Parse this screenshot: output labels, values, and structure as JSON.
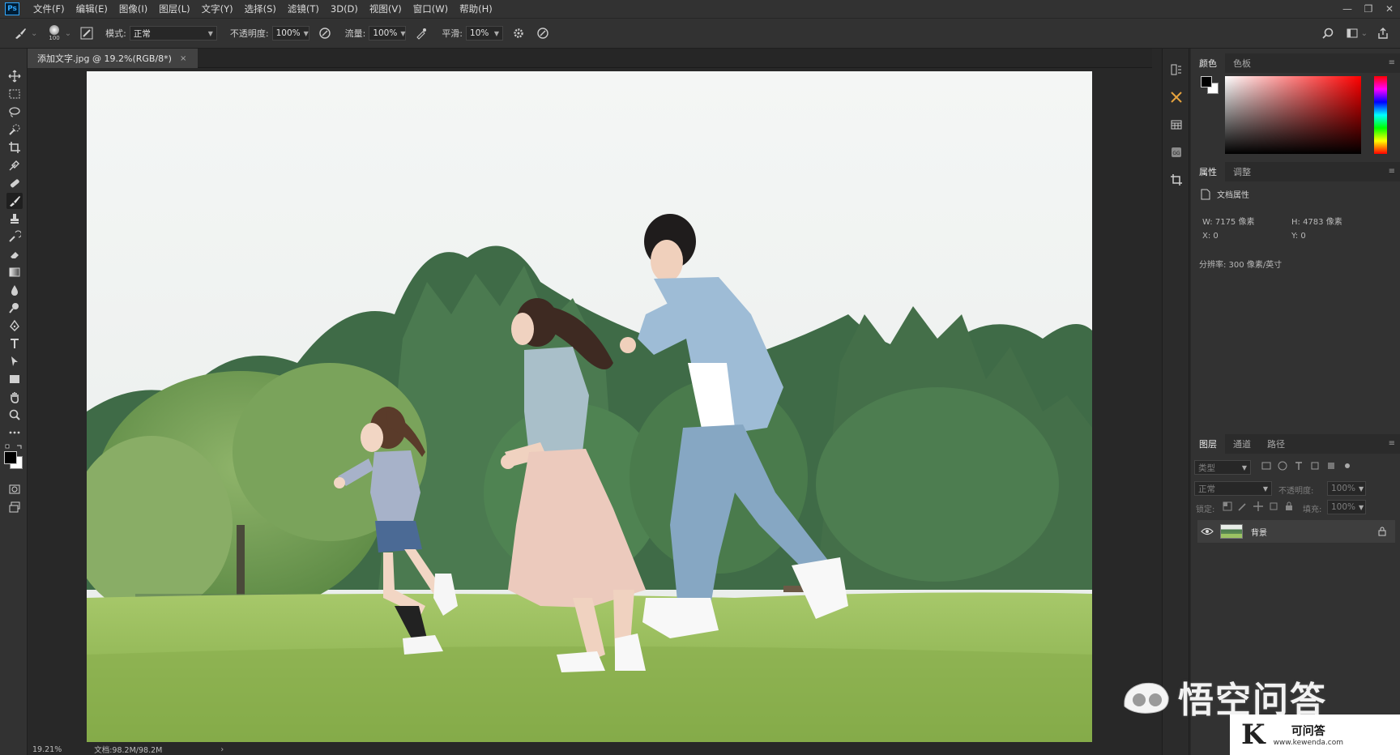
{
  "app": {
    "logo": "Ps"
  },
  "menus": [
    "文件(F)",
    "编辑(E)",
    "图像(I)",
    "图层(L)",
    "文字(Y)",
    "选择(S)",
    "滤镜(T)",
    "3D(D)",
    "视图(V)",
    "窗口(W)",
    "帮助(H)"
  ],
  "window_controls": [
    "minimize-icon",
    "restore-icon",
    "close-icon"
  ],
  "options": {
    "brush_size": "100",
    "mode_label": "模式:",
    "mode_value": "正常",
    "opacity_label": "不透明度:",
    "opacity_value": "100%",
    "flow_label": "流量:",
    "flow_value": "100%",
    "smooth_label": "平滑:",
    "smooth_value": "10%"
  },
  "document": {
    "tab_title": "添加文字.jpg @ 19.2%(RGB/8*)",
    "tab_close": "×",
    "zoom": "19.21%",
    "doc_size": "文档:98.2M/98.2M",
    "status_arrow": "›"
  },
  "color_panel": {
    "tabs": [
      "颜色",
      "色板"
    ]
  },
  "properties_panel": {
    "tabs": [
      "属性",
      "调整"
    ],
    "section_title": "文档属性",
    "width": "W:  7175 像素",
    "height": "H:  4783 像素",
    "x": "X:  0",
    "y": "Y:  0",
    "resolution": "分辨率: 300 像素/英寸"
  },
  "layers_panel": {
    "tabs": [
      "图层",
      "通道",
      "路径"
    ],
    "filter_placeholder": "类型",
    "blend_mode": "正常",
    "opacity_label": "不透明度:",
    "opacity_value": "100%",
    "lock_label": "锁定:",
    "fill_label": "填充:",
    "fill_value": "100%",
    "layers": [
      {
        "name": "背景",
        "visible": true,
        "locked": true
      }
    ]
  },
  "watermark": {
    "brand": "悟空问答",
    "logo_letter": "K",
    "site_name": "可问答",
    "site_url": "www.kewenda.com"
  },
  "colors": {
    "foreground": "#000000",
    "background": "#ffffff",
    "accent": "#31a8ff",
    "picker_hue": "#ff0000"
  }
}
